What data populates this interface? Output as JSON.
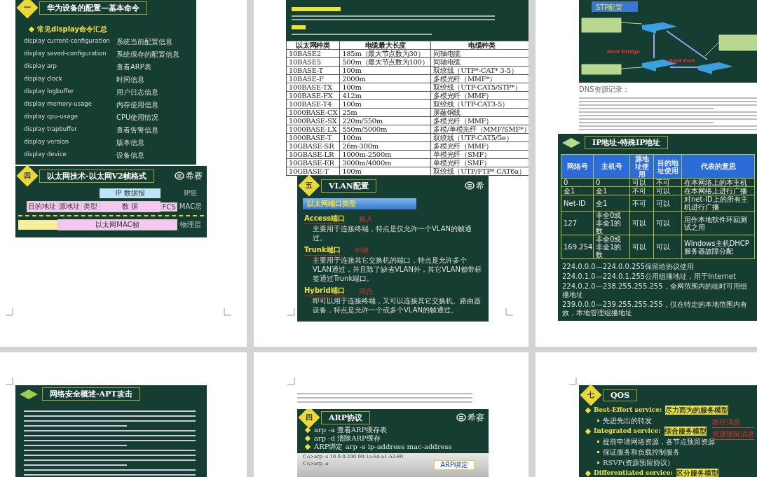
{
  "rows": [
    {
      "pages": [
        {
          "blocks": [
            {
              "kind": "commands",
              "badge": "一",
              "title": "华为设备的配置—基本命令",
              "heading": "常见display命令汇总",
              "commands": [
                {
                  "command": "display  current-configuration",
                  "description": "系统当前配置信息"
                },
                {
                  "command": "display  saved-configuration",
                  "description": "系统保存的配置信息"
                },
                {
                  "command": "display arp",
                  "description": "查看ARP表"
                },
                {
                  "command": "display clock",
                  "description": "时间信息"
                },
                {
                  "command": "display logbuffer",
                  "description": "用户日志信息"
                },
                {
                  "command": "display memory-usage",
                  "description": "内存使用信息"
                },
                {
                  "command": "display cpu-usage",
                  "description": "CPU使用情况"
                },
                {
                  "command": "display trapbuffer",
                  "description": "查看告警信息"
                },
                {
                  "command": "display version",
                  "description": "版本信息"
                },
                {
                  "command": "display device",
                  "description": "设备信息"
                }
              ]
            },
            {
              "kind": "frame",
              "badge": "四",
              "title": "以太网技术-以太网V2帧格式",
              "logo": "希赛",
              "ip_packet": "IP 数据报",
              "fields": [
                "目的地址",
                "源地址",
                "类型",
                "数 据",
                "FCS"
              ],
              "mac_frame": "以太网MAC帧",
              "layers": [
                "IP层",
                "MAC层",
                "物理层"
              ]
            }
          ]
        },
        {
          "blocks": [
            {
              "kind": "cable-table",
              "columns": [
                "以太网种类",
                "电缆最大长度",
                "电缆种类"
              ],
              "rows": [
                [
                  "10BASE2",
                  "185m（最大节点数为30）",
                  "同轴电缆"
                ],
                [
                  "10BASE5",
                  "500m（最大节点数为100）",
                  "同轴电缆"
                ],
                [
                  "10BASE-T",
                  "100m",
                  "双绞线（UTP*-CAT* 3-5）"
                ],
                [
                  "10BASE-F",
                  "2000m",
                  "多模光纤（MMF*）"
                ],
                [
                  "100BASE-TX",
                  "100m",
                  "双绞线（UTP-CAT5/STP*）"
                ],
                [
                  "100BASE-FX",
                  "412m",
                  "多模光纤（MMF）"
                ],
                [
                  "100BASE-T4",
                  "100m",
                  "双绞线（UTP-CAT3-5）"
                ],
                [
                  "1000BASE-CX",
                  "25m",
                  "屏蔽铜线"
                ],
                [
                  "1000BASE-SX",
                  "220m/550m",
                  "多模光纤（MMF）"
                ],
                [
                  "1000BASE-LX",
                  "550m/5000m",
                  "多模/单模光纤（MMF/SMF*）"
                ],
                [
                  "1000BASE-T",
                  "100m",
                  "双绞线（UTP-CAT5/5e）"
                ],
                [
                  "10GBASE-SR",
                  "26m-300m",
                  "多模光纤（MMF）"
                ],
                [
                  "10GBASE-LR",
                  "1000m-2500m",
                  "单模光纤（SMF）"
                ],
                [
                  "10GBASE-ER",
                  "3000m/4000m",
                  "单模光纤（SMF）"
                ],
                [
                  "10GBASE-T",
                  "100m",
                  "双绞线（UTP/FTP* CAT6a）"
                ]
              ]
            },
            {
              "kind": "vlan",
              "badge": "五",
              "title": "VLAN配置",
              "logo": "希",
              "bar": "以太网端口类型",
              "items": [
                {
                  "label": "Access端口",
                  "tag": "接入",
                  "description": "主要用于连接终端，特点是仅允许一个VLAN的帧通过。"
                },
                {
                  "label": "Trunk端口",
                  "tag": "中继",
                  "description": "主要用于连接其它交换机的端口，特点是允许多个VLAN通过，并且除了缺省VLAN外，其它VLAN都带标签通过Trunk端口。"
                },
                {
                  "label": "Hybrid端口",
                  "tag": "混合",
                  "description": "即可以用于连接终端，又可以连接其它交换机、路由器设备，特点是允许一个或多个VLAN的帧通过。"
                }
              ]
            }
          ]
        },
        {
          "blocks": [
            {
              "kind": "stp",
              "label": "STP配置",
              "root_bridge": "Root Bridge",
              "root_port": "Root Port"
            },
            {
              "kind": "doc-text",
              "heading": "DNS资源记录："
            },
            {
              "kind": "ip",
              "title": "IP地址-特殊IP地址",
              "columns": [
                "网络号",
                "主机号",
                "源地址使用",
                "目的地址使用",
                "代表的意思"
              ],
              "rows": [
                [
                  "0",
                  "0",
                  "可以",
                  "不可",
                  "在本网络上的本主机"
                ],
                [
                  "全1",
                  "全1",
                  "不可",
                  "可以",
                  "在本网络上进行广播"
                ],
                [
                  "Net-ID",
                  "全1",
                  "不可",
                  "可以",
                  "对net-ID上的所有主机进行广播"
                ],
                [
                  "127",
                  "非全0或非全1的数",
                  "可以",
                  "可以",
                  "用作本地软件环回测试之用"
                ],
                [
                  "169.254",
                  "非全0或非全1的数",
                  "可以",
                  "可以",
                  "Windows主机DHCP服务器故障分配"
                ]
              ],
              "lines": [
                "224.0.0.0—224.0.0.255保留给协议使用",
                "224.0.1.0—224.0.1.255公用组播地址，用于Internet",
                "224.0.2.0—238.255.255.255，全网范围内的临时可用组播地址",
                "239.0.0.0—239.255.255.255，仅在特定的本地范围内有效，本地管理组播地址"
              ]
            }
          ]
        }
      ]
    },
    {
      "pages": [
        {
          "blocks": [
            {
              "kind": "apt",
              "title": "网络安全概述-APT攻击"
            }
          ]
        },
        {
          "blocks": [
            {
              "kind": "doc-text"
            },
            {
              "kind": "arp",
              "badge": "四",
              "title": "ARP协议",
              "logo": "希赛",
              "bullets": [
                "arp -a  查看ARP缓存表",
                "arp -d  清除ARP缓存",
                "ARP绑定      arp -s ip-address mac-address"
              ],
              "terminal": [
                "C:\\>arp -s 10.0.0.200 00-1a-64-a1-52-80",
                "C:\\>arp -a"
              ],
              "callout": "ARP绑定"
            }
          ]
        },
        {
          "blocks": [
            {
              "kind": "qos",
              "badge": "七",
              "title": "QOS",
              "notes": [
                "路径消息",
                "资源预留消息"
              ],
              "items": [
                {
                  "kind": "main",
                  "en": "Best-Effort service:",
                  "zh": "尽力而为的服务模型"
                },
                {
                  "kind": "sub",
                  "text": "先进先出的转发"
                },
                {
                  "kind": "main",
                  "en": "Integrated service:",
                  "zh": "综合服务模型"
                },
                {
                  "kind": "sub",
                  "text": "提前申请网络资源，各节点预留资源"
                },
                {
                  "kind": "sub",
                  "text": "保证服务和负载控制服务"
                },
                {
                  "kind": "sub",
                  "text": "RSVP(资源预留协议)"
                },
                {
                  "kind": "main",
                  "en": "Differentiated service:",
                  "zh": "区分服务模型"
                }
              ]
            }
          ]
        }
      ]
    }
  ]
}
